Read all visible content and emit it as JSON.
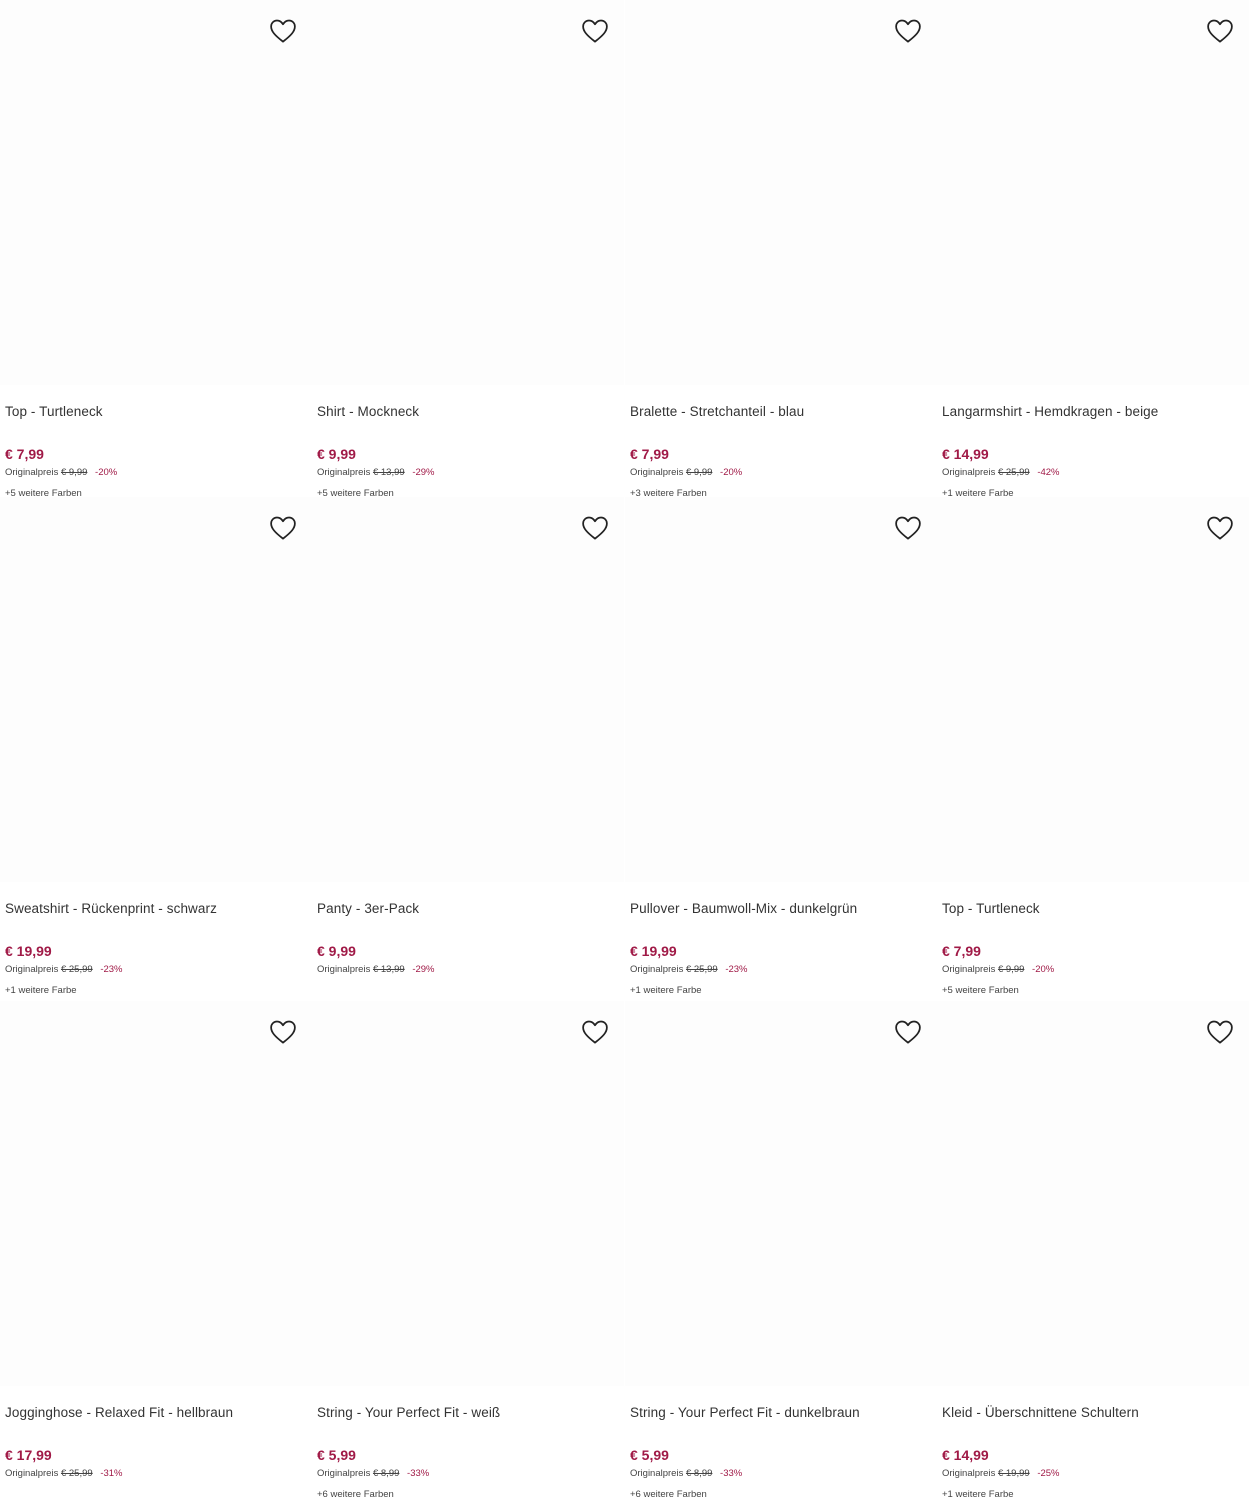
{
  "colors": {
    "price": "#a01a47",
    "text": "#333333"
  },
  "icons": {
    "wishlist": "heart-outline-icon"
  },
  "labels": {
    "original_price_prefix": "Originalpreis"
  },
  "products": [
    {
      "name": "Top - Turtleneck",
      "price": "€ 7,99",
      "original_price": "€ 9,99",
      "discount": "-20%",
      "more_colors": "+5 weitere Farben"
    },
    {
      "name": "Shirt - Mockneck",
      "price": "€ 9,99",
      "original_price": "€ 13,99",
      "discount": "-29%",
      "more_colors": "+5 weitere Farben"
    },
    {
      "name": "Bralette - Stretchanteil - blau",
      "price": "€ 7,99",
      "original_price": "€ 9,99",
      "discount": "-20%",
      "more_colors": "+3 weitere Farben"
    },
    {
      "name": "Langarmshirt - Hemdkragen - beige",
      "price": "€ 14,99",
      "original_price": "€ 25,99",
      "discount": "-42%",
      "more_colors": "+1 weitere Farbe"
    },
    {
      "name": "Sweatshirt - Rückenprint - schwarz",
      "price": "€ 19,99",
      "original_price": "€ 25,99",
      "discount": "-23%",
      "more_colors": "+1 weitere Farbe"
    },
    {
      "name": "Panty - 3er-Pack",
      "price": "€ 9,99",
      "original_price": "€ 13,99",
      "discount": "-29%",
      "more_colors": ""
    },
    {
      "name": "Pullover - Baumwoll-Mix - dunkelgrün",
      "price": "€ 19,99",
      "original_price": "€ 25,99",
      "discount": "-23%",
      "more_colors": "+1 weitere Farbe"
    },
    {
      "name": "Top - Turtleneck",
      "price": "€ 7,99",
      "original_price": "€ 9,99",
      "discount": "-20%",
      "more_colors": "+5 weitere Farben"
    },
    {
      "name": "Jogginghose - Relaxed Fit - hellbraun",
      "price": "€ 17,99",
      "original_price": "€ 25,99",
      "discount": "-31%",
      "more_colors": ""
    },
    {
      "name": "String - Your Perfect Fit - weiß",
      "price": "€ 5,99",
      "original_price": "€ 8,99",
      "discount": "-33%",
      "more_colors": "+6 weitere Farben"
    },
    {
      "name": "String - Your Perfect Fit - dunkelbraun",
      "price": "€ 5,99",
      "original_price": "€ 8,99",
      "discount": "-33%",
      "more_colors": "+6 weitere Farben"
    },
    {
      "name": "Kleid - Überschnittene Schultern",
      "price": "€ 14,99",
      "original_price": "€ 19,99",
      "discount": "-25%",
      "more_colors": "+1 weitere Farbe"
    }
  ]
}
